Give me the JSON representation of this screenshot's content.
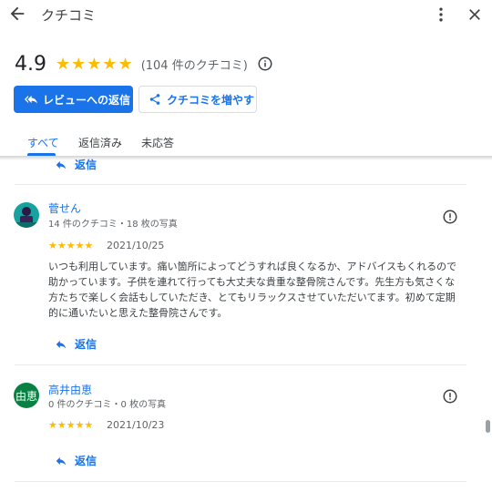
{
  "header": {
    "title": "クチコミ",
    "back_icon": "arrow-back-icon",
    "more_icon": "more-vert-icon",
    "close_icon": "close-icon"
  },
  "summary": {
    "rating": "4.9",
    "stars": "★★★★★",
    "count_text": "(104 件のクチコミ)",
    "info_icon": "info-icon"
  },
  "actions": {
    "reply_reviews_label": "レビューへの返信",
    "share_label": "クチコミを増やす"
  },
  "tabs": [
    {
      "label": "すべて",
      "active": true
    },
    {
      "label": "返信済み",
      "active": false
    },
    {
      "label": "未応答",
      "active": false
    }
  ],
  "reply_label": "返信",
  "reviews": [
    {
      "name": "菅せん",
      "meta": "14 件のクチコミ・18 枚の写真",
      "stars": "★★★★★",
      "date": "2021/10/25",
      "text": "いつも利用しています。痛い箇所によってどうすれば良くなるか、アドバイスもくれるので助かっています。子供を連れて行っても大丈夫な貴重な整骨院さんです。先生方も気さくな方たちで楽しく会話もしていただき、とてもリラックスさせていただいてます。初めて定期的に通いたいと思えた整骨院さんです。"
    },
    {
      "name": "高井由恵",
      "avatar_text": "由恵",
      "meta": "0 件のクチコミ・0 枚の写真",
      "stars": "★★★★★",
      "date": "2021/10/23"
    }
  ],
  "colors": {
    "accent": "#1a73e8",
    "star": "#fbbc04",
    "avatar_green": "#0b8043"
  }
}
